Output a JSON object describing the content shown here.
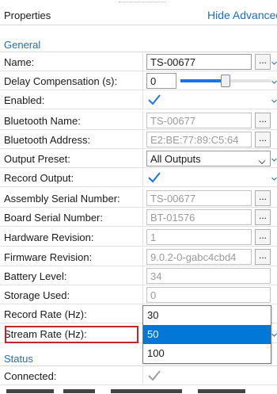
{
  "panel": {
    "title": "Properties",
    "hide_advanced_label": "Hide Advanced"
  },
  "groups": {
    "general": "General",
    "status": "Status"
  },
  "rows": {
    "name": {
      "label": "Name:",
      "value": "TS-00677"
    },
    "delay": {
      "label": "Delay Compensation (s):",
      "value": "0",
      "slider_level": 0.5
    },
    "enabled": {
      "label": "Enabled:",
      "checked": true
    },
    "bt_name": {
      "label": "Bluetooth Name:",
      "value": "TS-00677"
    },
    "bt_address": {
      "label": "Bluetooth Address:",
      "value": "E2:BE:77:89:C5:64"
    },
    "output_preset": {
      "label": "Output Preset:",
      "value": "All Outputs"
    },
    "record_output": {
      "label": "Record Output:",
      "checked": true
    },
    "assembly_serial": {
      "label": "Assembly Serial Number:",
      "value": "TS-00677"
    },
    "board_serial": {
      "label": "Board Serial Number:",
      "value": "BT-01576"
    },
    "hw_revision": {
      "label": "Hardware Revision:",
      "value": "1"
    },
    "fw_revision": {
      "label": "Firmware Revision:",
      "value": "9.0.2-0-gabc4cbd4"
    },
    "battery": {
      "label": "Battery Level:",
      "value": "34"
    },
    "storage": {
      "label": "Storage Used:",
      "value": "0"
    },
    "record_rate": {
      "label": "Record Rate (Hz):"
    },
    "stream_rate": {
      "label": "Stream Rate (Hz):"
    },
    "connected": {
      "label": "Connected:",
      "checked": true
    }
  },
  "rate_dropdown": {
    "options": [
      "30",
      "50",
      "100"
    ],
    "selected_index": 1
  },
  "colors": {
    "link_blue": "#1b6ec2",
    "selection_blue": "#0078d7",
    "slider_blue": "#1a73e8",
    "highlight_red": "#c0272d"
  },
  "icons": {
    "chevron": "chevron-down-icon",
    "check": "checkmark-icon",
    "ellipsis": "ellipsis-button"
  }
}
